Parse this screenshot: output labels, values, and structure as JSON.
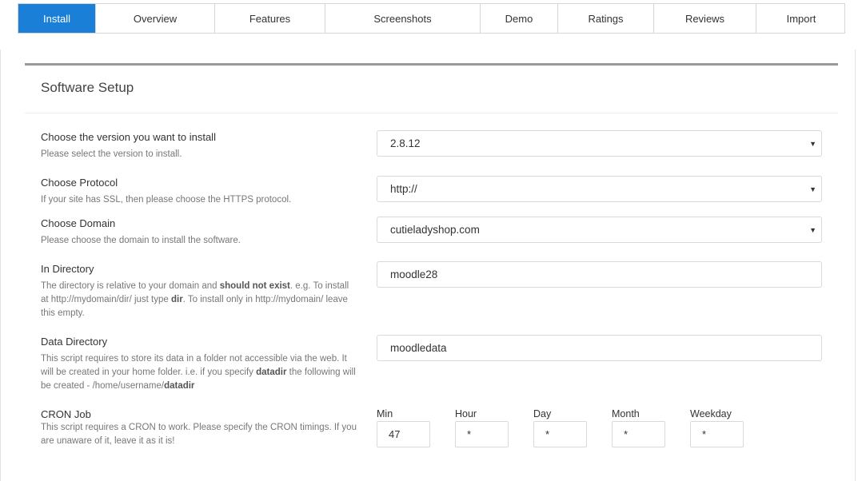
{
  "tabs": [
    {
      "label": "Install"
    },
    {
      "label": "Overview"
    },
    {
      "label": "Features"
    },
    {
      "label": "Screenshots"
    },
    {
      "label": "Demo"
    },
    {
      "label": "Ratings"
    },
    {
      "label": "Reviews"
    },
    {
      "label": "Import"
    }
  ],
  "section_title": "Software Setup",
  "version": {
    "label": "Choose the version you want to install",
    "hint": "Please select the version to install.",
    "value": "2.8.12"
  },
  "protocol": {
    "label": "Choose Protocol",
    "hint": "If your site has SSL, then please choose the HTTPS protocol.",
    "value": "http://"
  },
  "domain": {
    "label": "Choose Domain",
    "hint": "Please choose the domain to install the software.",
    "value": "cutieladyshop.com"
  },
  "directory": {
    "label": "In Directory",
    "hint_1": "The directory is relative to your domain and ",
    "hint_bold_1": "should not exist",
    "hint_2": ". e.g. To install at http://mydomain/dir/ just type ",
    "hint_bold_2": "dir",
    "hint_3": ". To install only in http://mydomain/ leave this empty.",
    "value": "moodle28"
  },
  "data_directory": {
    "label": "Data Directory",
    "hint_1": "This script requires to store its data in a folder not accessible via the web. It will be created in your home folder. i.e. if you specify ",
    "hint_bold_1": "datadir",
    "hint_2": " the following will be created - /home/username/",
    "hint_bold_2": "datadir",
    "value": "moodledata"
  },
  "cron": {
    "label": "CRON Job",
    "hint": "This script requires a CRON to work. Please specify the CRON timings. If you are unaware of it, leave it as it is!",
    "fields": [
      {
        "label": "Min",
        "value": "47"
      },
      {
        "label": "Hour",
        "value": "*"
      },
      {
        "label": "Day",
        "value": "*"
      },
      {
        "label": "Month",
        "value": "*"
      },
      {
        "label": "Weekday",
        "value": "*"
      }
    ]
  },
  "icons": {
    "dropdown": "caret-down-icon"
  },
  "colors": {
    "active_tab": "#1a7fd6"
  }
}
